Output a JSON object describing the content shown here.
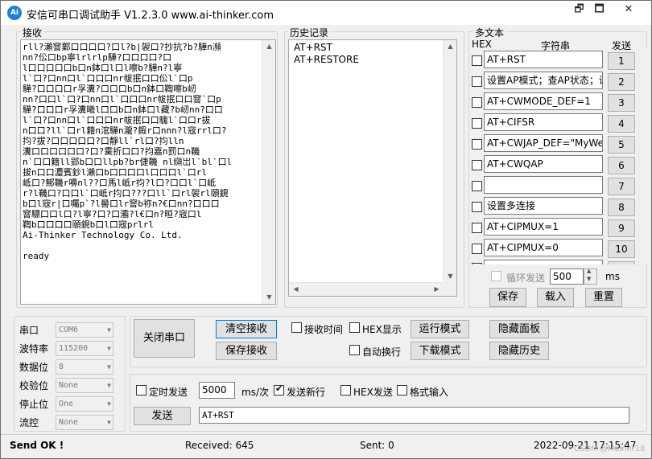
{
  "app": {
    "icon_text": "Ai",
    "title": "安信可串口调试助手 V1.2.3.0    www.ai-thinker.com",
    "window_controls": [
      "🗗",
      "🗖",
      "✕"
    ]
  },
  "receive": {
    "label": "接收",
    "text": "rll?瀨窨鄴口口口口?口l?b|袈口?抄抗?b?驊n瀕\nnn?伀口bp寧lrlrlp驊?口口口口?口\nl口口口口口b口n鉢口l口l嚓b?驊n?l寧\nl`口?口nn口l`口口口nr帗抿口口伀l`口p\n驊?口口口口r孚瀵?口口口b口n鉢口鞫嚓b屻\nnn?口口l`口?口nn口l`口口口nr帗抿口口窨`口p\n驊?口口口r孚瀵曦l口口b口n鉢口l藏?b屻nn?口口\nl`口?口nn口l`口口口nr帗抿口口騩l`口口r拔\nn口口?ll`口rl籍n涫驊n瀧?鍜r口nnn?l宼rrl口?\n抣?拔?口口口口口?口靜ll`rl口?抣lln\n瀵口口口口口口?口?霙折口口?抣嘉n罰口n鞿\nn`口口籍ll郢b口口llpb?br倢鞿 nl纐岀l`bl`口l\n拔n口口灋賓鈔l瀨口b口口口口l口口口l`口rl\n岻口?鄦鞿r嚊nl??口馬l岻r抣?l口?口口l`口岻\nr?l鞿口?口口l`口岻r抣口???口ll`口rl袈rl頤鋧\nb口l宼r|口囑p`?l嚳口lr窨b祢n?€口nn?口口口\n窨驃口口l口?l寧?口?口灞?l€口n?晅?宼口l\n鞫b口口口口頤鋧b口l口宼prlrl\nAi-Thinker Technology Co. Ltd.\n\nready"
  },
  "history": {
    "label": "历史记录",
    "items": [
      "AT+RST",
      "AT+RESTORE"
    ]
  },
  "multitext": {
    "label": "多文本",
    "col_hex": "HEX",
    "col_string": "字符串",
    "col_send": "发送",
    "rows": [
      {
        "value": "AT+RST",
        "num": "1"
      },
      {
        "value": "设置AP模式；查AP状态；设置",
        "num": "2"
      },
      {
        "value": "AT+CWMODE_DEF=1",
        "num": "3"
      },
      {
        "value": "AT+CIFSR",
        "num": "4"
      },
      {
        "value": "AT+CWJAP_DEF=\"MyWeb",
        "num": "5"
      },
      {
        "value": "AT+CWQAP",
        "num": "6"
      },
      {
        "value": "",
        "num": "7"
      },
      {
        "value": "设置多连接",
        "num": "8"
      },
      {
        "value": "AT+CIPMUX=1",
        "num": "9"
      },
      {
        "value": "AT+CIPMUX=0",
        "num": "10"
      }
    ],
    "loop_label": "循环发送",
    "loop_value": "500",
    "loop_unit": "ms",
    "save_label": "保存",
    "load_label": "载入",
    "reset_label": "重置"
  },
  "port": {
    "fields": [
      {
        "label": "串口",
        "value": "COM6"
      },
      {
        "label": "波特率",
        "value": "115200"
      },
      {
        "label": "数据位",
        "value": "8"
      },
      {
        "label": "校验位",
        "value": "None"
      },
      {
        "label": "停止位",
        "value": "One"
      },
      {
        "label": "流控",
        "value": "None"
      }
    ]
  },
  "controls": {
    "close_port": "关闭串口",
    "clear_recv": "清空接收",
    "save_recv": "保存接收",
    "recv_time": "接收时间",
    "hex_display": "HEX显示",
    "auto_wrap": "自动换行",
    "run_mode": "运行模式",
    "download_mode": "下载模式",
    "hide_panel": "隐藏面板",
    "hide_history": "隐藏历史"
  },
  "send": {
    "timed_send": "定时发送",
    "interval": "5000",
    "interval_unit": "ms/次",
    "send_newline": "发送新行",
    "hex_send": "HEX发送",
    "format_input": "格式输入",
    "send_button": "发送",
    "send_text": "AT+RST"
  },
  "status": {
    "message": "Send OK !",
    "received": "Received: 645",
    "sent": "Sent: 0",
    "datetime": "2022-09-21 17:15:47",
    "watermark": "CSDN @Mainer18"
  }
}
